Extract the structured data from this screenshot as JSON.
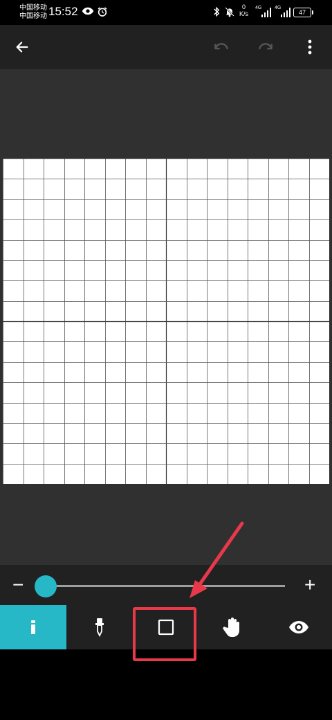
{
  "status_bar": {
    "carrier_1": "中国移动",
    "carrier_2": "中国移动",
    "time": "15:52",
    "net_speed_value": "0",
    "net_speed_unit": "K/s",
    "signal_1": "4G",
    "signal_2": "4G",
    "battery": "47"
  },
  "toolbar": {
    "back_icon": "arrow-left-icon",
    "undo_icon": "undo-icon",
    "redo_icon": "redo-icon",
    "menu_icon": "more-vert-icon"
  },
  "slider": {
    "minus_label": "−",
    "plus_label": "+",
    "value_fraction": 0.0,
    "accent_color": "#26b8c6"
  },
  "tools": [
    {
      "name": "pencil",
      "icon": "pencil-icon",
      "active": true
    },
    {
      "name": "eyedropper",
      "icon": "eyedropper-icon",
      "active": false
    },
    {
      "name": "rectangle",
      "icon": "square-icon",
      "active": false
    },
    {
      "name": "pan",
      "icon": "hand-icon",
      "active": false
    },
    {
      "name": "preview",
      "icon": "eye-icon",
      "active": false
    }
  ],
  "grid": {
    "columns": 16,
    "rows": 16
  },
  "annotation": {
    "color": "#e8394a"
  }
}
